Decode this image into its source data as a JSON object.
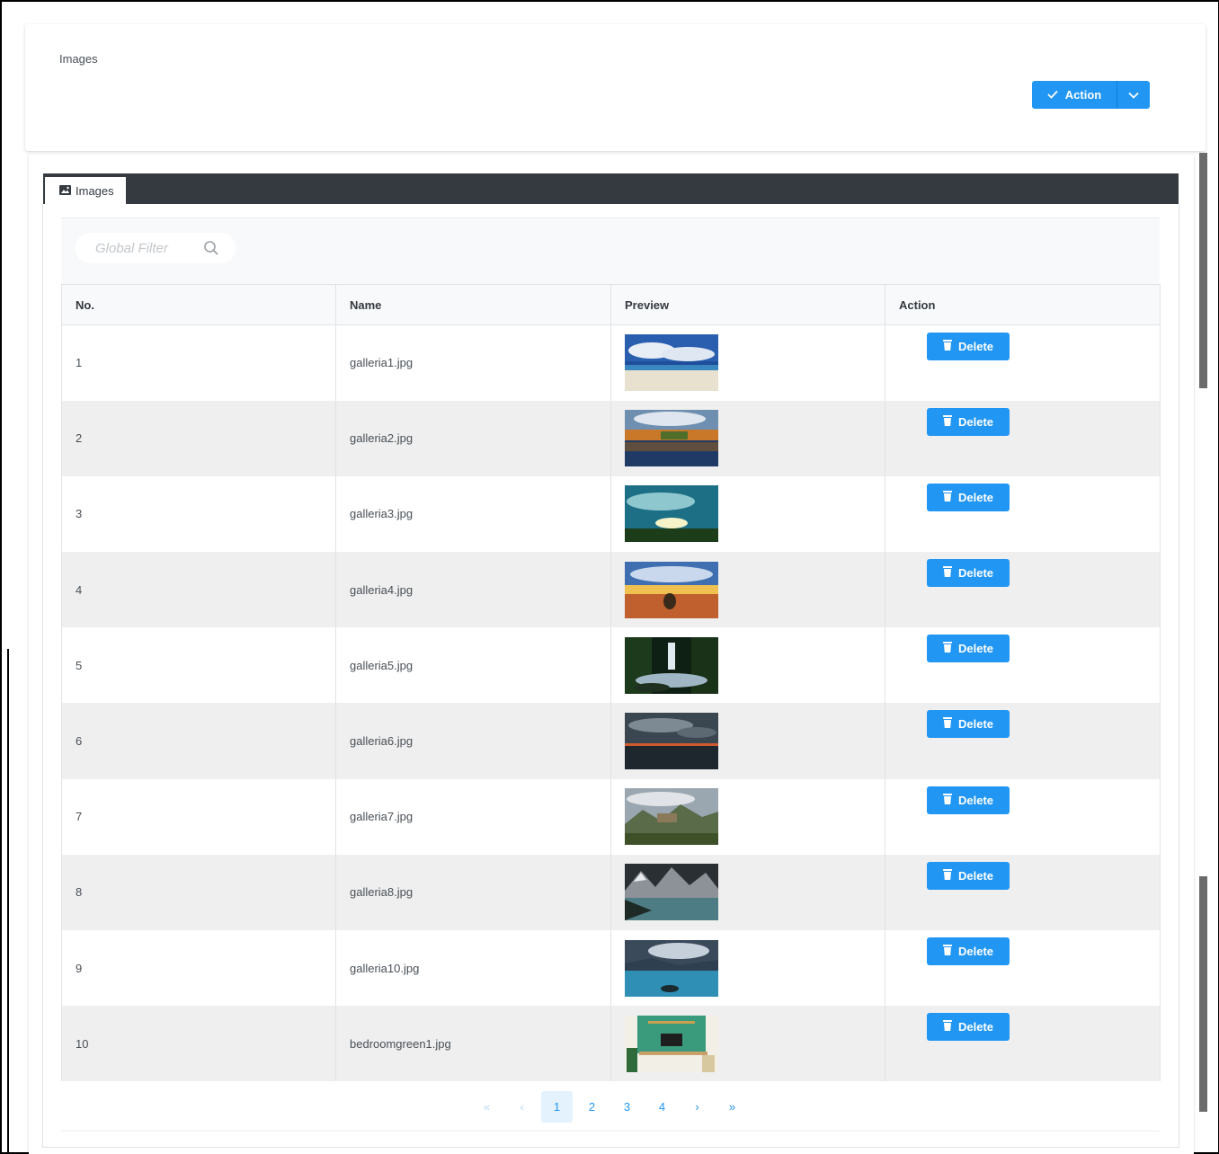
{
  "header": {
    "title": "Images",
    "action_label": "Action"
  },
  "tabs": [
    {
      "label": "Images"
    }
  ],
  "filter": {
    "placeholder": "Global Filter"
  },
  "table": {
    "columns": [
      "No.",
      "Name",
      "Preview",
      "Action"
    ],
    "delete_label": "Delete",
    "rows": [
      {
        "no": "1",
        "name": "galleria1.jpg",
        "preview": "beach-sky"
      },
      {
        "no": "2",
        "name": "galleria2.jpg",
        "preview": "autumn-lake"
      },
      {
        "no": "3",
        "name": "galleria3.jpg",
        "preview": "sunset-field"
      },
      {
        "no": "4",
        "name": "galleria4.jpg",
        "preview": "desert-sunset"
      },
      {
        "no": "5",
        "name": "galleria5.jpg",
        "preview": "waterfall"
      },
      {
        "no": "6",
        "name": "galleria6.jpg",
        "preview": "stormy-sea"
      },
      {
        "no": "7",
        "name": "galleria7.jpg",
        "preview": "mountain-ruins"
      },
      {
        "no": "8",
        "name": "galleria8.jpg",
        "preview": "mountain-lake"
      },
      {
        "no": "9",
        "name": "galleria10.jpg",
        "preview": "cloudy-lake"
      },
      {
        "no": "10",
        "name": "bedroomgreen1.jpg",
        "preview": "green-room"
      }
    ]
  },
  "pagination": {
    "first": "«",
    "prev": "‹",
    "next": "›",
    "last": "»",
    "pages": [
      "1",
      "2",
      "3",
      "4"
    ],
    "current": "1"
  },
  "colors": {
    "primary": "#2196f3",
    "tabbar": "#343a40"
  },
  "icons": {
    "action": "check-icon",
    "dropdown": "chevron-down-icon",
    "tab": "image-icon",
    "filter": "search-icon",
    "delete": "trash-icon"
  }
}
